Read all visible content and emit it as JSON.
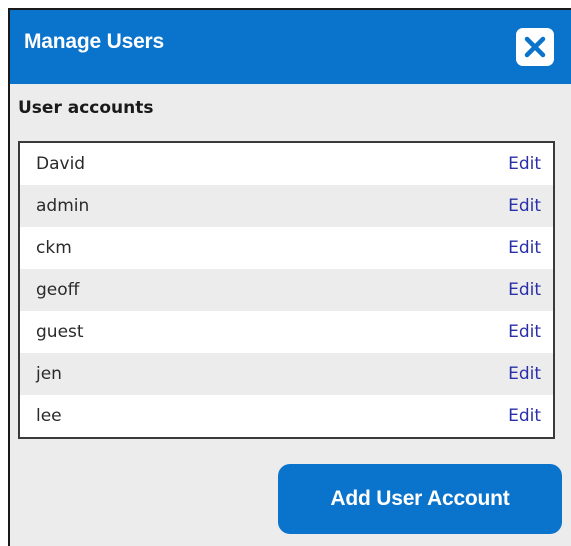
{
  "dialog": {
    "title": "Manage Users",
    "close_icon": "close-x-icon"
  },
  "section": {
    "label": "User accounts"
  },
  "users": [
    {
      "name": "David",
      "action": "Edit"
    },
    {
      "name": "admin",
      "action": "Edit"
    },
    {
      "name": "ckm",
      "action": "Edit"
    },
    {
      "name": "geoff",
      "action": "Edit"
    },
    {
      "name": "guest",
      "action": "Edit"
    },
    {
      "name": "jen",
      "action": "Edit"
    },
    {
      "name": "lee",
      "action": "Edit"
    }
  ],
  "actions": {
    "add_label": "Add User Account"
  },
  "colors": {
    "accent": "#0a73cc",
    "link": "#2a2fa8",
    "panel": "#ececec"
  }
}
